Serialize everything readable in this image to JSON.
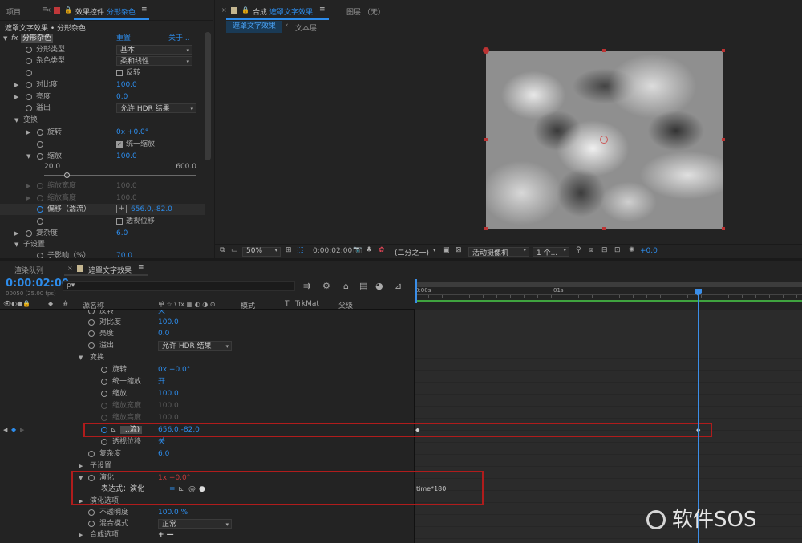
{
  "top_tabs": {
    "project": "项目",
    "effect_controls_prefix": "效果控件",
    "effect_controls_target": "分形杂色",
    "comp_prefix": "合成",
    "comp_name": "遮罩文字效果",
    "layer_tab": "图层 （无）"
  },
  "effect_panel": {
    "layer_path": "遮罩文字效果 • 分形杂色",
    "fx_label": "fx",
    "effect_name": "分形杂色",
    "reset": "重置",
    "about": "关于...",
    "fractal_type_label": "分形类型",
    "fractal_type_value": "基本",
    "noise_type_label": "杂色类型",
    "noise_type_value": "柔和线性",
    "invert_label": "反转",
    "contrast_label": "对比度",
    "contrast_value": "100.0",
    "brightness_label": "亮度",
    "brightness_value": "0.0",
    "overflow_label": "溢出",
    "overflow_value": "允许 HDR 结果",
    "transform_label": "变换",
    "rotation_label": "旋转",
    "rotation_value": "0x +0.0°",
    "uniform_scale_label": "统一缩放",
    "scale_label": "缩放",
    "scale_value": "100.0",
    "slider_min": "20.0",
    "slider_max": "600.0",
    "scale_width_label": "缩放宽度",
    "scale_width_value": "100.0",
    "scale_height_label": "缩放高度",
    "scale_height_value": "100.0",
    "offset_label": "偏移（湍流）",
    "offset_value": "656.0,-82.0",
    "perspective_label": "透视位移",
    "complexity_label": "复杂度",
    "complexity_value": "6.0",
    "sub_settings_label": "子设置",
    "sub_influence_label": "子影响（%）",
    "sub_influence_value": "70.0"
  },
  "comp_view": {
    "comp_tab": "遮罩文字效果",
    "text_layer_tab": "文本层",
    "zoom": "50%",
    "timecode": "0:00:02:00",
    "resolution": "(二分之一)",
    "camera": "活动摄像机",
    "views": "1 个...",
    "exposure": "+0.0"
  },
  "timeline": {
    "render_queue_tab": "渲染队列",
    "comp_tab": "遮罩文字效果",
    "timecode": "0:00:02:00",
    "frame_info": "00050 (25.00 fps)",
    "search_placeholder": "ρ▾",
    "col_hash": "#",
    "col_source": "源名称",
    "col_switches": "单 ☆ \\ fx ▦ ◐ ◑ ⊙",
    "col_mode": "模式",
    "col_t": "T",
    "col_trkmat": "TrkMat",
    "col_parent": "父级",
    "ruler_start": "0:00s",
    "ruler_mid": "01s",
    "rows": {
      "invert_partial": "反转",
      "invert_value": "关",
      "contrast": "对比度",
      "contrast_value": "100.0",
      "brightness": "亮度",
      "brightness_value": "0.0",
      "overflow": "溢出",
      "overflow_value": "允许 HDR 结果",
      "transform": "变换",
      "rotation": "旋转",
      "rotation_value": "0x +0.0°",
      "uniform_scale": "统一缩放",
      "uniform_scale_value": "开",
      "scale": "缩放",
      "scale_value": "100.0",
      "scale_width": "缩放宽度",
      "scale_width_value": "100.0",
      "scale_height": "缩放高度",
      "scale_height_value": "100.0",
      "offset": "...流)",
      "offset_value": "656.0,-82.0",
      "perspective": "透视位移",
      "perspective_value": "关",
      "complexity": "复杂度",
      "complexity_value": "6.0",
      "sub_settings": "子设置",
      "evolution": "演化",
      "evolution_value": "1x +0.0°",
      "expression_label": "表达式：演化",
      "expression_code": "time*180",
      "evolution_options": "演化选项",
      "opacity": "不透明度",
      "opacity_value": "100.0 %",
      "blend_mode": "混合模式",
      "blend_mode_value": "正常",
      "composite_options": "合成选项",
      "composite_add": "+ —"
    }
  },
  "watermark": "软件SOS",
  "colors": {
    "accent_blue": "#2d8ceb",
    "highlight_red": "#b01c1c",
    "playhead": "#3b8ee8",
    "work_area_green": "#3fa33f"
  }
}
